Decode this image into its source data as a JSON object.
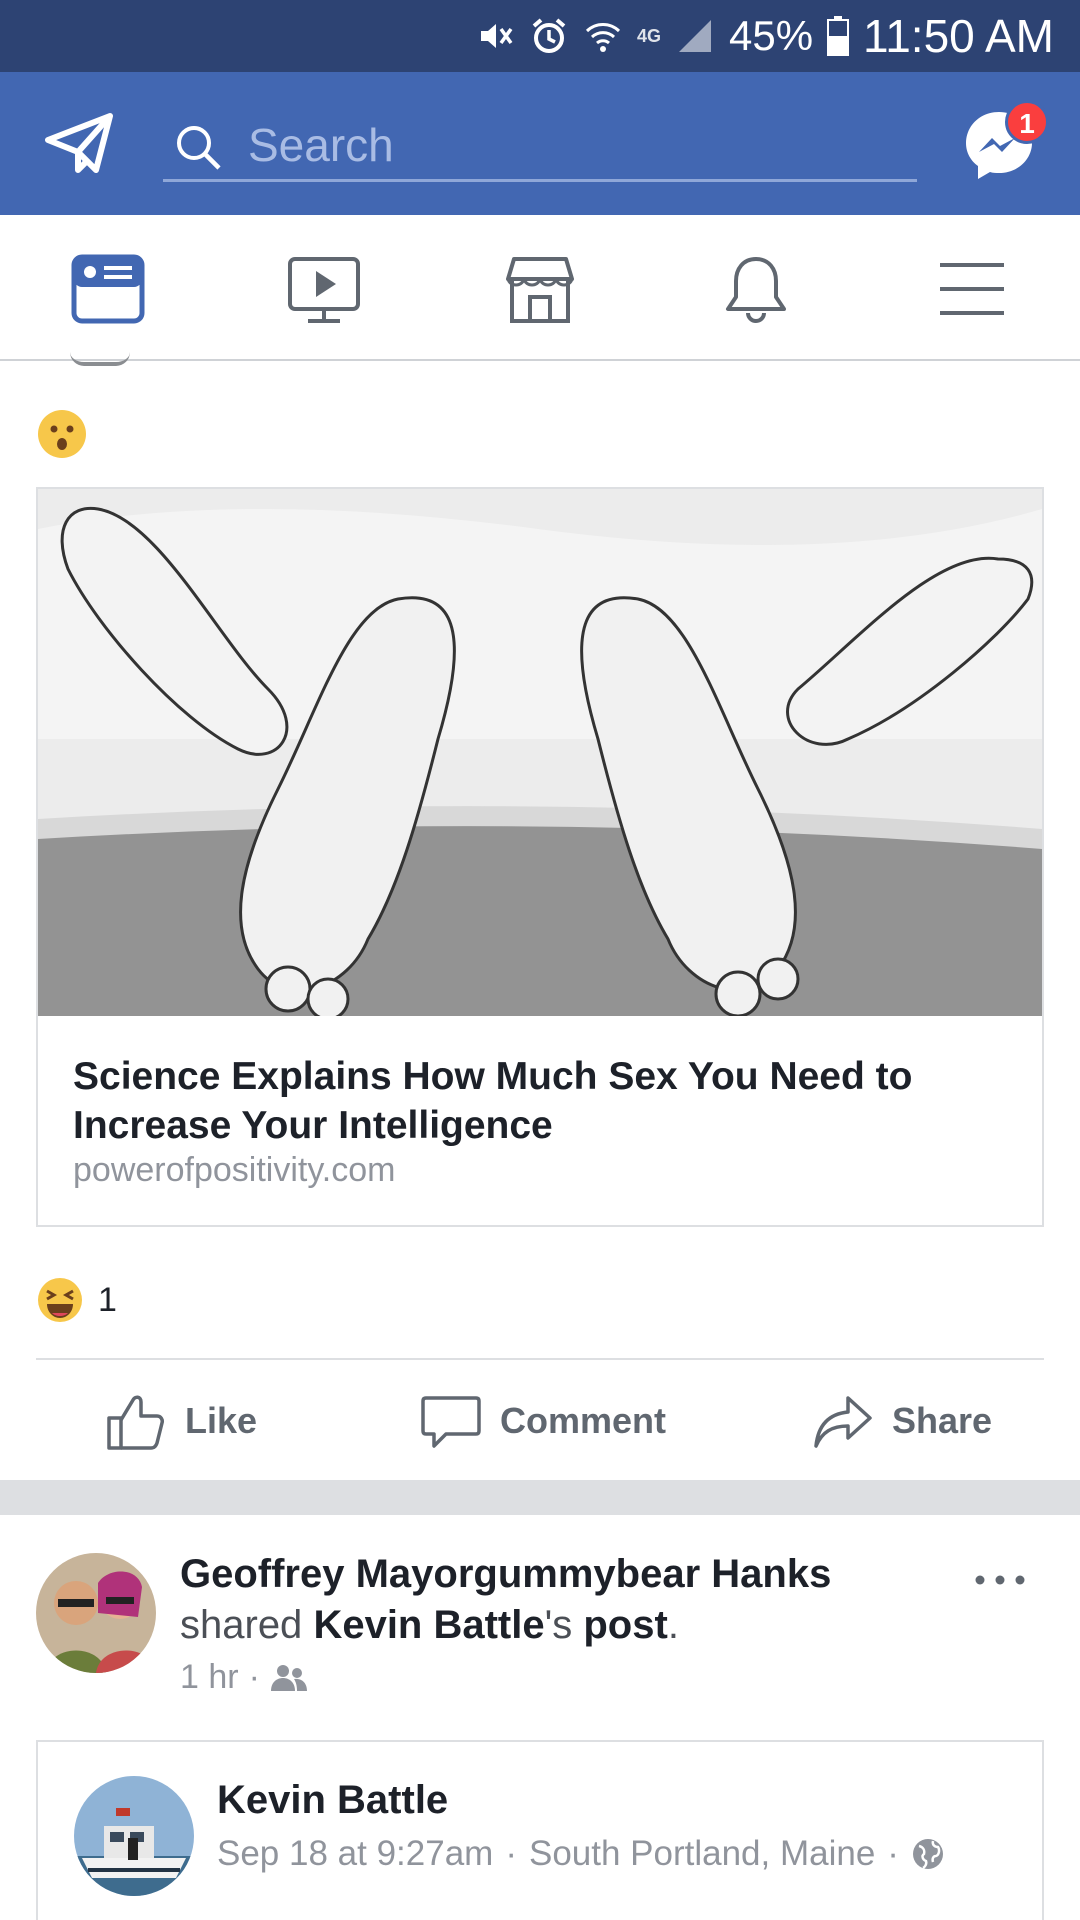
{
  "status_bar": {
    "network": "4G",
    "battery": "45%",
    "time": "11:50 AM",
    "icons": [
      "mute-icon",
      "alarm-icon",
      "wifi-icon",
      "signal-icon",
      "battery-icon"
    ]
  },
  "header": {
    "search_placeholder": "Search",
    "messenger_badge": "1",
    "brand_color": "#4267b2"
  },
  "nav_tabs": [
    {
      "name": "news-feed",
      "icon": "news-feed-icon",
      "active": true
    },
    {
      "name": "watch",
      "icon": "watch-icon"
    },
    {
      "name": "marketplace",
      "icon": "marketplace-icon"
    },
    {
      "name": "notifications",
      "icon": "bell-icon"
    },
    {
      "name": "menu",
      "icon": "hamburger-icon"
    }
  ],
  "post1": {
    "status_emoji": "surprised-face",
    "link": {
      "title": "Science Explains How Much Sex You Need to Increase Your Intelligence",
      "domain": "powerofpositivity.com"
    },
    "reaction_count": "1",
    "actions": {
      "like": "Like",
      "comment": "Comment",
      "share": "Share"
    }
  },
  "post2": {
    "author": "Geoffrey Mayorgummybear Hanks",
    "shared_prefix": "shared",
    "shared_owner": "Kevin Battle",
    "shared_suffix": "'s",
    "shared_object": "post",
    "period": ".",
    "time": "1 hr",
    "separator": "·",
    "shared_post": {
      "author": "Kevin Battle",
      "date": "Sep 18 at 9:27am",
      "location": "South Portland, Maine"
    }
  }
}
